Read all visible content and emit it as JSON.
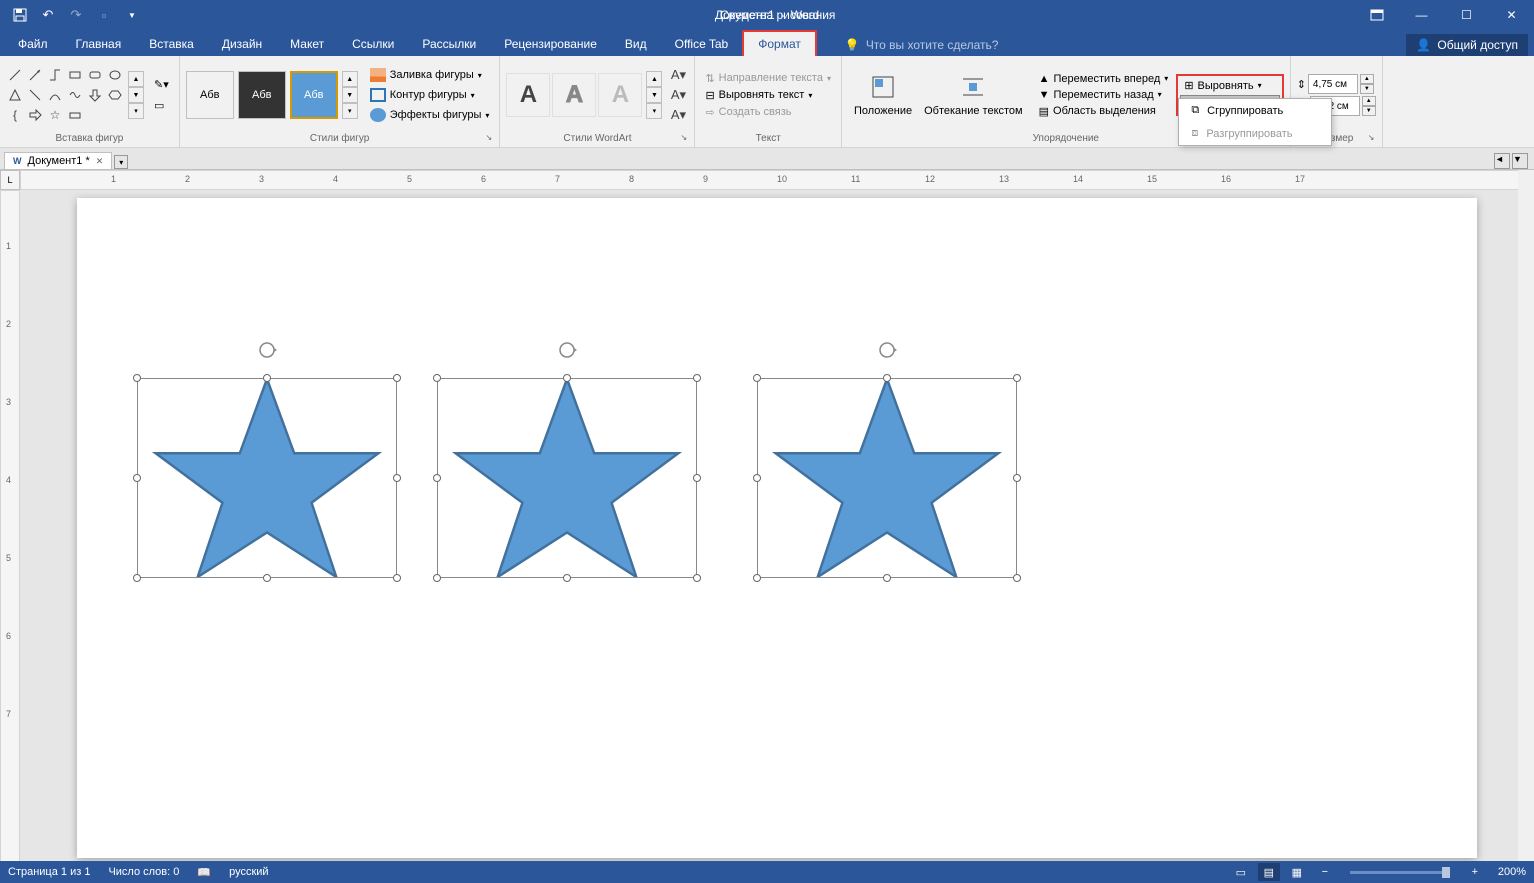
{
  "title": {
    "doc": "Документ1",
    "app": "Word",
    "context": "Средства рисования"
  },
  "qat": {
    "save": "💾",
    "undo": "↶",
    "redo": "↷",
    "new": "📄"
  },
  "tabs": {
    "file": "Файл",
    "home": "Главная",
    "insert": "Вставка",
    "design": "Дизайн",
    "layout": "Макет",
    "references": "Ссылки",
    "mailings": "Рассылки",
    "review": "Рецензирование",
    "view": "Вид",
    "officetab": "Office Tab",
    "format": "Формат",
    "tellme": "Что вы хотите сделать?"
  },
  "share": "Общий доступ",
  "ribbon": {
    "shapes": {
      "label": "Вставка фигур"
    },
    "styles": {
      "label": "Стили фигур",
      "sample": "Абв",
      "fill": "Заливка фигуры",
      "outline": "Контур фигуры",
      "effects": "Эффекты фигуры"
    },
    "wordart": {
      "label": "Стили WordArt"
    },
    "text": {
      "label": "Текст",
      "direction": "Направление текста",
      "align": "Выровнять текст",
      "link": "Создать связь"
    },
    "position": "Положение",
    "wrap": "Обтекание текстом",
    "arrange": {
      "label": "Упорядочение",
      "forward": "Переместить вперед",
      "backward": "Переместить назад",
      "selpane": "Область выделения",
      "alignO": "Выровнять",
      "group": "Группировать",
      "group_dd": {
        "group": "Сгруппировать",
        "ungroup": "Разгруппировать"
      }
    },
    "size": {
      "label": "Размер",
      "height": "4,75 см",
      "width": "6,52 см"
    }
  },
  "doctab": {
    "name": "Документ1 *"
  },
  "status": {
    "page": "Страница 1 из 1",
    "words": "Число слов: 0",
    "lang": "русский",
    "zoom": "200%"
  },
  "ruler_marks": [
    "1",
    "2",
    "3",
    "4",
    "5",
    "6",
    "7",
    "8",
    "9",
    "10",
    "11",
    "12",
    "13",
    "14",
    "15",
    "16",
    "17"
  ]
}
